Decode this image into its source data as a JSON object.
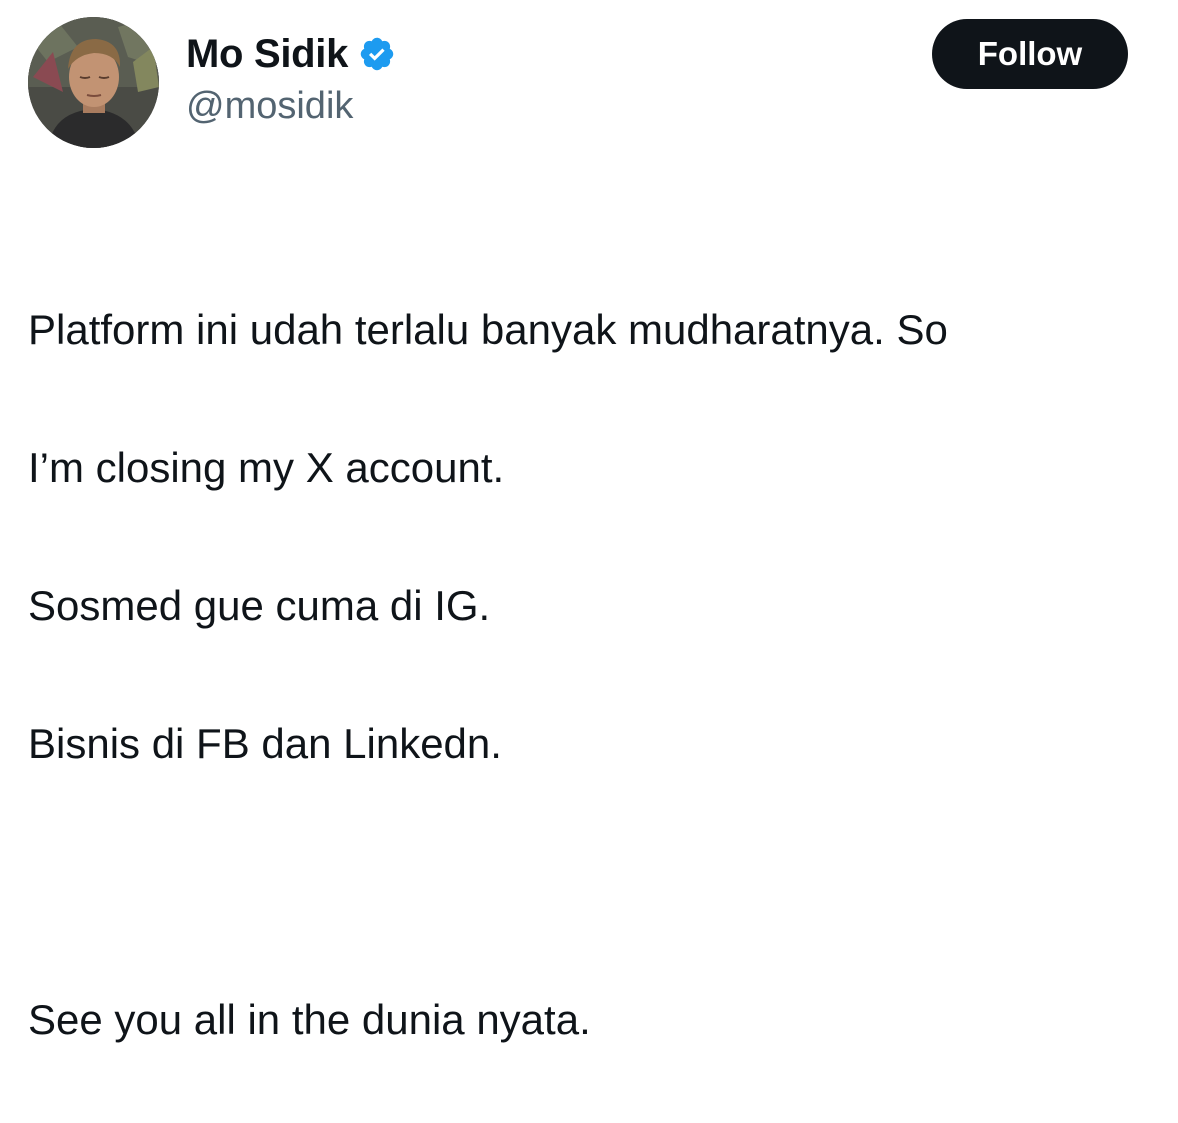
{
  "author": {
    "display_name": "Mo Sidik",
    "handle": "@mosidik",
    "verified": true,
    "verified_color": "#1d9bf0",
    "avatar_icon": "user-photo-avatar"
  },
  "actions": {
    "follow_label": "Follow"
  },
  "tweet": {
    "lines": [
      "Platform ini udah terlalu banyak mudharatnya. So",
      "I’m closing my X account.",
      "Sosmed gue cuma di IG.",
      "Bisnis di FB dan Linkedn.",
      "",
      "See you all in the dunia nyata."
    ]
  }
}
